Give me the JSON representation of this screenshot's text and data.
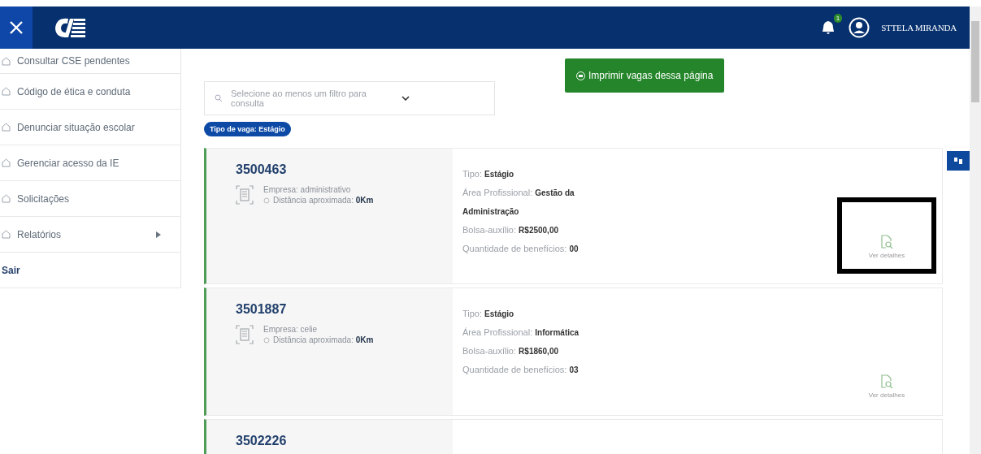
{
  "header": {
    "notification_count": "1",
    "user_name": "STTELA MIRANDA"
  },
  "sidebar": {
    "items": [
      {
        "label": "Consultar CSE pendentes",
        "kind": "link"
      },
      {
        "label": "Código de ética e conduta",
        "kind": "link"
      },
      {
        "label": "Denunciar situação escolar",
        "kind": "link"
      },
      {
        "label": "Gerenciar acesso da IE",
        "kind": "link"
      },
      {
        "label": "Solicitações",
        "kind": "link"
      },
      {
        "label": "Relatórios",
        "kind": "submenu"
      },
      {
        "label": "Sair",
        "kind": "logout"
      }
    ]
  },
  "filter": {
    "placeholder": "Selecione ao menos um filtro para consulta",
    "chips": [
      "Tipo de vaga: Estágio"
    ]
  },
  "print_button": "Imprimir vagas dessa página",
  "vacancies": [
    {
      "code": "3500463",
      "company": "Empresa: administrativo",
      "distance_label": "Distância aproximada:",
      "distance": "0Km",
      "details": [
        {
          "label": "Tipo:",
          "value": "Estágio"
        },
        {
          "label": "Área Profissional:",
          "value": "Gestão da Administração"
        },
        {
          "label": "Bolsa-auxílio:",
          "value": "R$2500,00"
        },
        {
          "label": "Quantidade de benefícios:",
          "value": "00"
        }
      ],
      "action": "Ver detalhes",
      "highlighted": true
    },
    {
      "code": "3501887",
      "company": "Empresa: celie",
      "distance_label": "Distância aproximada:",
      "distance": "0Km",
      "details": [
        {
          "label": "Tipo:",
          "value": "Estágio"
        },
        {
          "label": "Área Profissional:",
          "value": "Informática"
        },
        {
          "label": "Bolsa-auxílio:",
          "value": "R$1860,00"
        },
        {
          "label": "Quantidade de benefícios:",
          "value": "03"
        }
      ],
      "action": "Ver detalhes",
      "highlighted": false
    },
    {
      "code": "3502226"
    }
  ]
}
